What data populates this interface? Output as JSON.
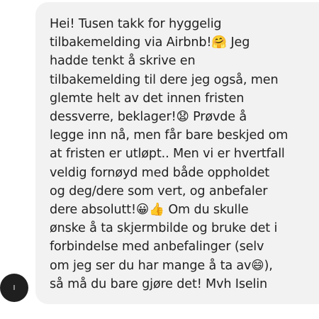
{
  "message": {
    "text": "Hei! Tusen takk for hyggelig tilbakemelding via Airbnb!🤗 Jeg hadde tenkt å skrive en tilbakemelding til dere jeg også, men glemte helt av det innen fristen dessverre, beklager!😧 Prøvde å legge inn nå, men får bare beskjed om at fristen er utløpt.. Men vi er hvertfall veldig fornøyd med både oppholdet og deg/dere som vert, og anbefaler dere absolutt!😀👍 Om du skulle ønske å ta skjermbilde og bruke det i forbindelse med anbefalinger (selv om jeg ser du har mange å ta av😄), så må du bare gjøre det! Mvh Iselin",
    "lines": [
      "Hei! Tusen takk for hyggelig",
      "tilbakemelding via Airbnb!🤗 Jeg",
      "hadde tenkt å skrive en",
      "tilbakemelding til dere jeg også, men",
      "glemte helt av det innen fristen",
      "dessverre, beklager!😧 Prøvde å",
      "legge inn nå, men får bare beskjed om",
      "at fristen er utløpt.. Men vi er hvertfall",
      "veldig fornøyd med både oppholdet",
      "og deg/dere som vert, og anbefaler",
      "dere absolutt!😀👍 Om du skulle",
      "ønske å ta skjermbilde og bruke det i",
      "forbindelse med anbefalinger (selv",
      "om jeg ser du har mange å ta av😄),",
      "så må du bare gjøre det! Mvh Iselin"
    ]
  },
  "sender": {
    "avatar_initial": "I"
  },
  "colors": {
    "bubble_background": "#f2f2f2",
    "text": "#222222",
    "avatar_background": "#1f1f1f"
  }
}
